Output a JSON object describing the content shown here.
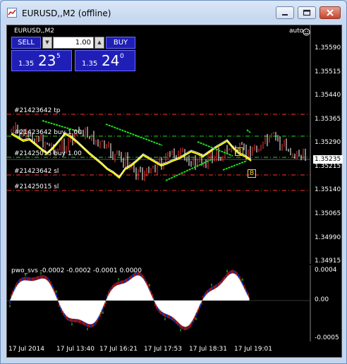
{
  "window": {
    "title": "EURUSD,,M2 (offline)"
  },
  "chart": {
    "symbol": "EURUSD,,M2",
    "auto_label": "auto",
    "current_price": "1.35235",
    "y_labels": [
      "1.35590",
      "1.35515",
      "1.35440",
      "1.35365",
      "1.35290",
      "1.35215",
      "1.35140",
      "1.35065",
      "1.34990",
      "1.34915"
    ],
    "trade_lines": [
      {
        "label": "#21423642 tp",
        "color": "#ff3333"
      },
      {
        "label": "#21423642 buy 1.00",
        "color": "#22dd22"
      },
      {
        "label": "#21425015 buy 1.00",
        "color": "#22dd22"
      },
      {
        "label": "#21423642 sl",
        "color": "#ff3333"
      },
      {
        "label": "#21425015 sl",
        "color": "#ff3333"
      }
    ],
    "markers": [
      "B",
      "B"
    ]
  },
  "trade_panel": {
    "sell_label": "SELL",
    "buy_label": "BUY",
    "lot": "1.00",
    "sell_quote": {
      "prefix": "1.35",
      "big": "23",
      "super": "5"
    },
    "buy_quote": {
      "prefix": "1.35",
      "big": "24",
      "super": "0"
    }
  },
  "indicator": {
    "title": "pwo_svs -0.0002 -0.0002 -0.0001 0.0000",
    "y_labels": [
      "0.0004",
      "0.00",
      "-0.0005"
    ]
  },
  "x_labels": [
    "17 Jul 2014",
    "17 Jul 13:40",
    "17 Jul 16:21",
    "17 Jul 17:53",
    "17 Jul 18:31",
    "17 Jul 19:01"
  ],
  "colors": {
    "bull": "#ff3333",
    "bear": "#ffffff",
    "ma_fast": "#ffff00",
    "ma_slow": "#ffffff",
    "trend": "#22dd22"
  }
}
